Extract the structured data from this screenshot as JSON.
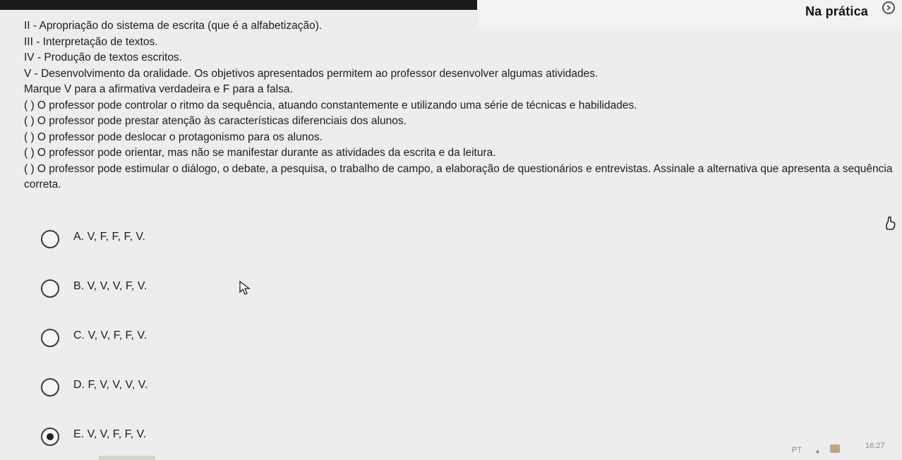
{
  "header": {
    "section_title": "Na prática"
  },
  "question": {
    "lines": [
      "II - Apropriação do sistema de escrita (que é a alfabetização).",
      "III - Interpretação de textos.",
      "IV - Produção de textos escritos.",
      "V - Desenvolvimento da oralidade. Os objetivos apresentados permitem ao professor desenvolver algumas atividades.",
      "Marque V para a afirmativa verdadeira e F para a falsa.",
      "( ) O professor pode controlar o ritmo da sequência, atuando constantemente e utilizando uma série de técnicas e habilidades.",
      "( ) O professor pode prestar atenção às características diferenciais dos alunos.",
      "( ) O professor pode deslocar o protagonismo para os alunos.",
      "( ) O professor pode orientar, mas não se manifestar durante as atividades da escrita e da leitura.",
      "( ) O professor pode estimular o diálogo, o debate, a pesquisa, o trabalho de campo, a elaboração de questionários e entrevistas. Assinale a alternativa que apresenta a sequência correta."
    ]
  },
  "options": [
    {
      "label": "A. V, F, F, F, V.",
      "selected": false
    },
    {
      "label": "B. V, V, V, F, V.",
      "selected": false
    },
    {
      "label": "C. V, V, F, F, V.",
      "selected": false
    },
    {
      "label": "D. F, V, V, V, V.",
      "selected": false
    },
    {
      "label": "E. V, V, F, F, V.",
      "selected": true
    }
  ],
  "taskbar": {
    "language": "PT",
    "time": "16:27"
  },
  "icons": {
    "top_right": "chevron-circle-icon",
    "side": "hand-icon",
    "cursor": "mouse-pointer-icon"
  }
}
